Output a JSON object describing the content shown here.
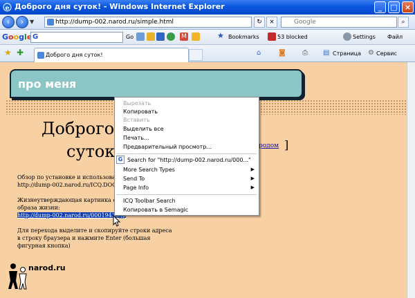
{
  "window": {
    "title": "Доброго дня суток! - Windows Internet Explorer"
  },
  "address_bar": {
    "url": "http://dump-002.narod.ru/simple.html",
    "search_placeholder": "Google"
  },
  "google_toolbar": {
    "go_label": "Go",
    "bookmarks_label": "Bookmarks",
    "blocked_label": "53 blocked",
    "settings_label": "Settings",
    "file_label": "Файл"
  },
  "tabs": {
    "active_label": "Доброго дня суток!"
  },
  "command_bar": {
    "page_label": "Страница",
    "service_label": "Сервис"
  },
  "page": {
    "header": "про меня",
    "title_line1": "Доброго",
    "title_line2": "суток!",
    "link_narod": "родом",
    "bracket": "]",
    "para1": "Обзор по установке и использовани",
    "para1_url": "http://dump-002.narod.ru/ICQ.DOC",
    "para2_line1": "Жизнеутверждающая картинка о",
    "para2_line2": "образа жизни:",
    "para2_selected": "http://dump-002.narod.ru/00019435.jp",
    "para3": "Для перехода выделите и скопируйте строки адреса в строку браузера и нажмите Enter (большая фигурная кнопка)",
    "logo": "narod.ru"
  },
  "context_menu": {
    "items": [
      {
        "label": "Вырезать",
        "disabled": true
      },
      {
        "label": "Копировать",
        "disabled": false
      },
      {
        "label": "Вставить",
        "disabled": true
      },
      {
        "label": "Выделить все",
        "disabled": false
      },
      {
        "label": "Печать...",
        "disabled": false
      },
      {
        "label": "Предварительный просмотр...",
        "disabled": false
      }
    ],
    "search_item": "Search for \"http://dump-002.narod.ru/000...\"",
    "submenus": [
      {
        "label": "More Search Types"
      },
      {
        "label": "Send To"
      },
      {
        "label": "Page Info"
      }
    ],
    "extra": [
      {
        "label": "ICQ Toolbar Search"
      },
      {
        "label": "Копировать в Semagic"
      }
    ]
  },
  "colors": {
    "page_bg": "#f7d0a4",
    "header_bg": "#8cc5c5",
    "titlebar": "#0a56e0",
    "selection": "#0a3bb1"
  }
}
